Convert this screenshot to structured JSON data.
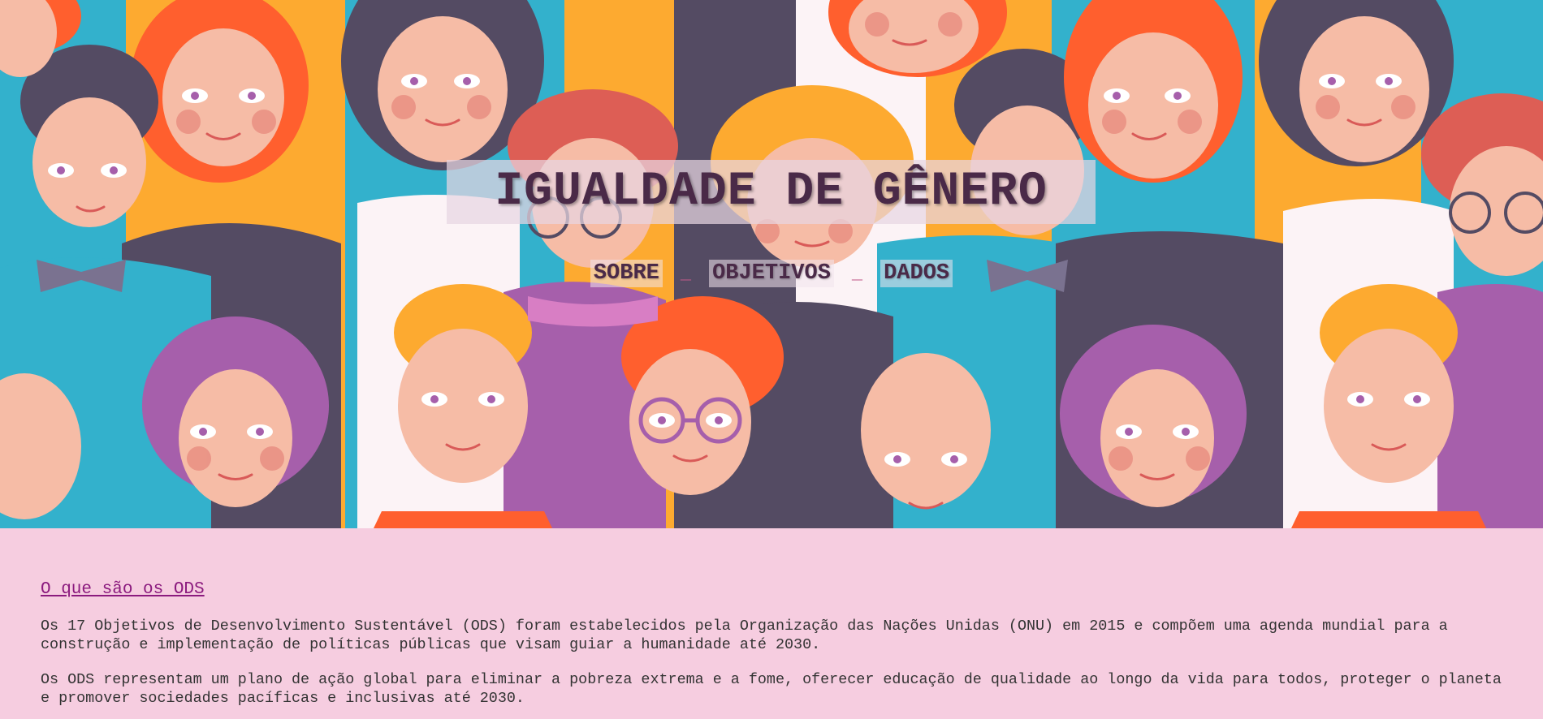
{
  "page": {
    "title": "IGUALDADE DE GÊNERO",
    "colors": {
      "background": "#f6cde0",
      "title": "#4a2a48",
      "link": "#8b1a7e",
      "text": "#333333"
    }
  },
  "hero": {
    "image": "illustration-diverse-people-faces",
    "nav": [
      {
        "label": "SOBRE"
      },
      {
        "label": "OBJETIVOS"
      },
      {
        "label": "DADOS"
      }
    ],
    "separator": "_"
  },
  "content": {
    "heading": "O que são os ODS",
    "paragraphs": [
      "Os 17 Objetivos de Desenvolvimento Sustentável (ODS) foram estabelecidos pela Organização das Nações Unidas (ONU) em 2015 e compõem uma agenda mundial para a construção e implementação de políticas públicas que visam guiar a humanidade até 2030.",
      "Os ODS representam um plano de ação global para eliminar a pobreza extrema e a fome, oferecer educação de qualidade ao longo da vida para todos, proteger o planeta e promover sociedades pacíficas e inclusivas até 2030."
    ]
  }
}
